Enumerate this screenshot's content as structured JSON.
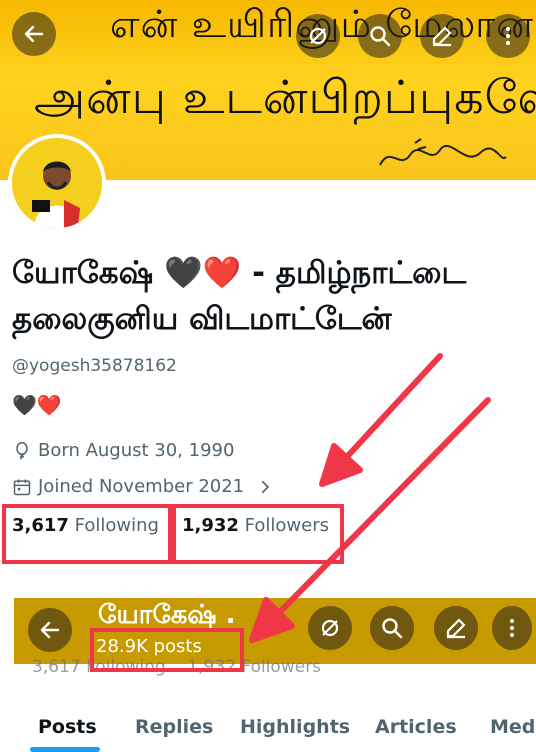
{
  "banner": {
    "line1": "என் உயிரினும் மேலான",
    "line2": "அன்பு உடன்பிறப்புகளே..."
  },
  "toolbar": {
    "back_icon": "back-arrow-icon",
    "grok_icon": "grok-icon",
    "search_icon": "search-icon",
    "edit_icon": "edit-icon",
    "more_icon": "more-vertical-icon"
  },
  "profile": {
    "name_line1": "யோகேஷ் 🖤❤️ - தமிழ்நாட்டை",
    "name_line2": "தலைகுனிய விடமாட்டேன்",
    "handle": "@yogesh35878162",
    "bio": "🖤❤️",
    "born": "Born August 30, 1990",
    "joined": "Joined November 2021",
    "following_count": "3,617",
    "following_label": "Following",
    "followers_count": "1,932",
    "followers_label": "Followers"
  },
  "mini_header": {
    "name": "யோகேஷ் .",
    "posts": "28.9K posts",
    "ghost_following": "3,617",
    "ghost_following_label": "Following",
    "ghost_followers": "1,932",
    "ghost_followers_label": "Followers"
  },
  "tabs": [
    "Posts",
    "Replies",
    "Highlights",
    "Articles",
    "Media"
  ],
  "colors": {
    "annotation_red": "#ef3748",
    "accent_blue": "#1d9bf0",
    "banner_yellow": "#ffd21f"
  }
}
